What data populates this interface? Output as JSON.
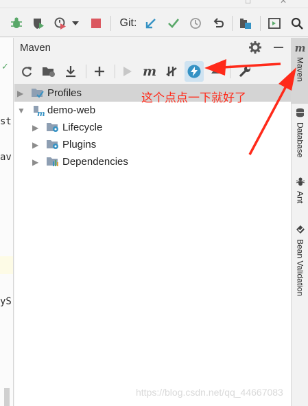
{
  "toolbar": {
    "git_label": "Git:",
    "icons": [
      "bug-icon",
      "coverage-icon",
      "profile-icon",
      "dropdown-icon",
      "stop-icon",
      "git-update-icon",
      "git-commit-icon",
      "history-icon",
      "revert-icon",
      "project-structure-icon",
      "terminal-icon",
      "search-icon"
    ]
  },
  "editor": {
    "lines": [
      {
        "text": "st"
      },
      {
        "text": "av"
      },
      {
        "text": "yS"
      }
    ]
  },
  "panel": {
    "title": "Maven",
    "header_icons": [
      "gear-icon",
      "minimize-icon"
    ],
    "toolbar_icons": [
      "reload-icon",
      "add-folder-icon",
      "download-icon",
      "plus-icon",
      "run-icon",
      "maven-icon",
      "skip-tests-icon",
      "offline-mode-icon",
      "collapse-icon",
      "wrench-icon"
    ]
  },
  "tree": {
    "items": [
      {
        "label": "Profiles",
        "level": 0,
        "expanded": false,
        "selected": true,
        "icon": "profiles-icon"
      },
      {
        "label": "demo-web",
        "level": 0,
        "expanded": true,
        "selected": false,
        "icon": "maven-module-icon"
      },
      {
        "label": "Lifecycle",
        "level": 1,
        "expanded": false,
        "selected": false,
        "icon": "lifecycle-folder-icon"
      },
      {
        "label": "Plugins",
        "level": 1,
        "expanded": false,
        "selected": false,
        "icon": "plugins-folder-icon"
      },
      {
        "label": "Dependencies",
        "level": 1,
        "expanded": false,
        "selected": false,
        "icon": "dependencies-icon"
      }
    ]
  },
  "annotation": {
    "text": "这个点点一下就好了",
    "color": "#ff2a1a"
  },
  "side_tabs": [
    {
      "label": "Maven",
      "active": true
    },
    {
      "label": "Database",
      "active": false
    },
    {
      "label": "Ant",
      "active": false
    },
    {
      "label": "Bean Validation",
      "active": false
    }
  ],
  "watermark": {
    "text": "https://blog.csdn.net/qq_44667083"
  },
  "colors": {
    "accent_blue": "#3592c4",
    "git_green": "#59a869",
    "stop_red": "#db5860",
    "annotation_red": "#ff2a1a"
  }
}
